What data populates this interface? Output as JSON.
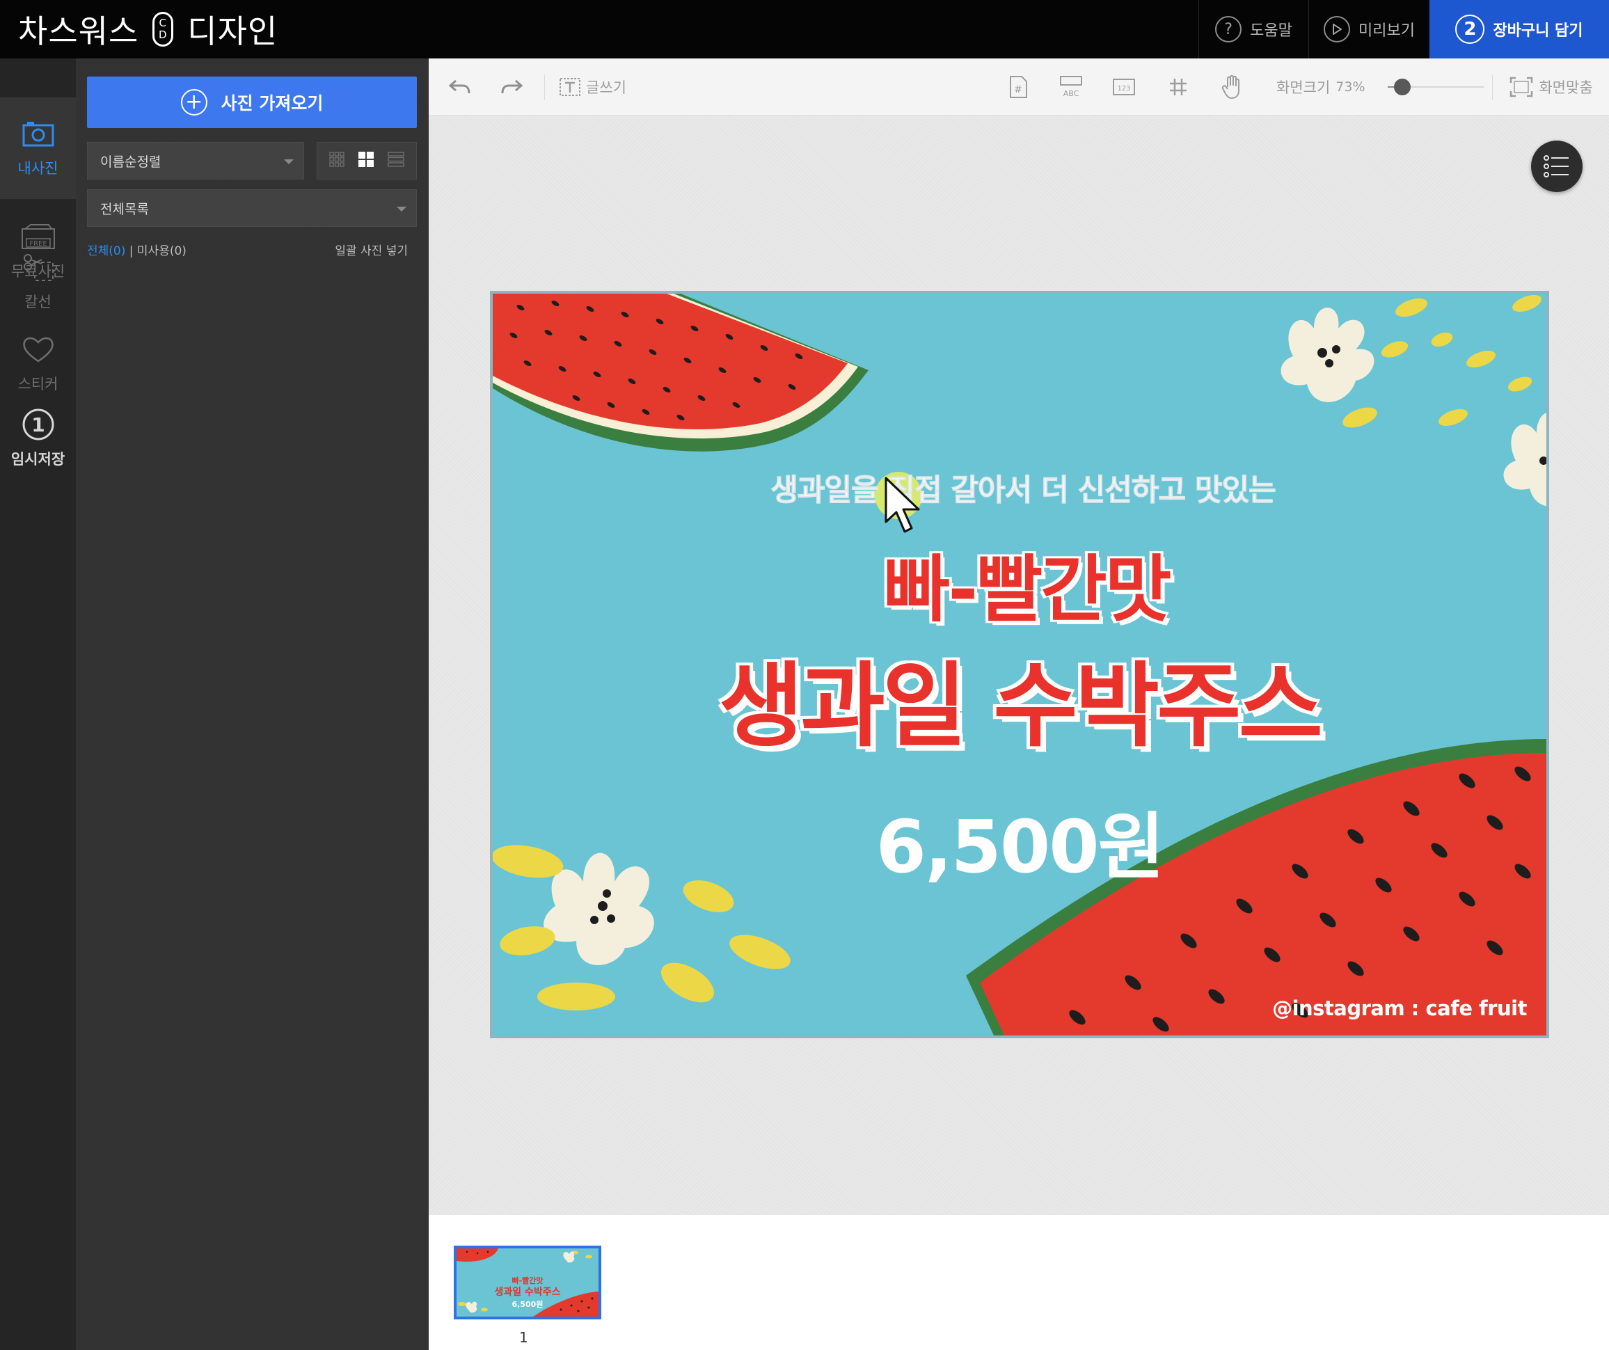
{
  "app": {
    "logo_left": "차스워스",
    "logo_mark_top": "C",
    "logo_mark_bottom": "D",
    "logo_right": "디자인"
  },
  "header": {
    "help_label": "도움말",
    "help_icon": "?",
    "preview_label": "미리보기",
    "cart_step": "2",
    "cart_label": "장바구니 담기",
    "cart_color": "#1e58d0"
  },
  "leftnav": {
    "items": [
      {
        "label": "내사진",
        "icon": "camera-icon",
        "active": true
      },
      {
        "label": "무료사진",
        "icon": "free-photo-icon"
      },
      {
        "label": "칼선",
        "icon": "scissors-icon"
      },
      {
        "label": "스티커",
        "icon": "heart-icon"
      },
      {
        "label": "임시저장",
        "icon": "number-one-icon",
        "badge": "1"
      }
    ],
    "active_color": "#2d8cf0"
  },
  "panel": {
    "import_label": "사진 가져오기",
    "sort_value": "이름순정렬",
    "list_value": "전체목록",
    "count_all": "전체(0)",
    "separator": "|",
    "count_unused": "미사용(0)",
    "bulk_insert": "일괄 사진 넣기",
    "accent": "#3d78ee"
  },
  "toolbar": {
    "text_label": "글쓰기",
    "zoom_label": "화면크기",
    "zoom_value": "73%",
    "zoom_percent": 73,
    "slider_fraction": 0.15,
    "fit_label": "화면맞춤",
    "icons": [
      "undo-icon",
      "redo-icon",
      "text-icon",
      "page-number-icon",
      "abc-icon",
      "123-icon",
      "grid-icon",
      "hand-icon",
      "fit-screen-icon"
    ]
  },
  "design": {
    "subtitle": "생과일을 직접 갈아서 더 신선하고 맛있는",
    "title_line1": "빠-빨간맛",
    "title_line2": "생과일 수박주스",
    "price": "6,500원",
    "instagram": "@instagram : cafe fruit",
    "background": "#6ac4d4",
    "red": "#e8322b"
  },
  "pages": {
    "thumb_line1": "빠-빨간맛",
    "thumb_line2": "생과일 수박주스",
    "thumb_line3": "6,500원",
    "page_number": "1"
  }
}
